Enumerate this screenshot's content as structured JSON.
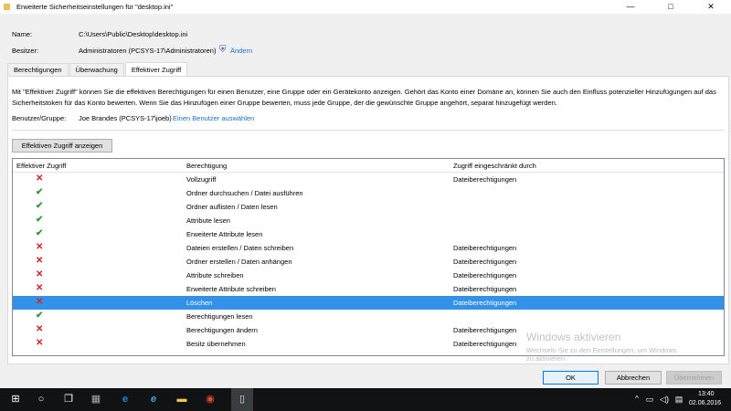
{
  "window": {
    "title": "Erweiterte Sicherheitseinstellungen für \"desktop.ini\"",
    "minimize": "—",
    "maximize": "□",
    "close": "✕"
  },
  "info": {
    "name_label": "Name:",
    "name_value": "C:\\Users\\Public\\Desktop\\desktop.ini",
    "owner_label": "Besitzer:",
    "owner_value": "Administratoren (PCSYS-17\\Administratoren)",
    "change_link": "Ändern"
  },
  "tabs": [
    {
      "label": "Berechtigungen"
    },
    {
      "label": "Überwachung"
    },
    {
      "label": "Effektiver Zugriff"
    }
  ],
  "panel": {
    "desc1": "Mit \"Effektiver Zugriff\" können Sie die effektiven Berechtigungen für einen Benutzer, eine Gruppe oder ein Gerätekonto anzeigen. Gehört das Konto einer Domäne an, können Sie auch den Einfluss potenzieller Hinzufügungen auf das",
    "desc2": "Sicherheitstoken für das Konto bewerten. Wenn Sie das Hinzufügen einer Gruppe bewerten, muss jede Gruppe, der die gewünschte Gruppe angehört, separat hinzugefügt werden.",
    "user_label": "Benutzer/Gruppe:",
    "user_value": "Joe Brandes (PCSYS-17\\joeb)",
    "select_user_link": "Einen Benutzer auswählen",
    "show_button": "Effektiven Zugriff anzeigen"
  },
  "table": {
    "headers": [
      "Effektiver Zugriff",
      "Berechtigung",
      "Zugriff eingeschränkt durch"
    ],
    "rows": [
      {
        "access": "denied",
        "permission": "Vollzugriff",
        "restricted": "Dateiberechtigungen"
      },
      {
        "access": "allowed",
        "permission": "Ordner durchsuchen / Datei ausführen",
        "restricted": ""
      },
      {
        "access": "allowed",
        "permission": "Ordner auflisten / Daten lesen",
        "restricted": ""
      },
      {
        "access": "allowed",
        "permission": "Attribute lesen",
        "restricted": ""
      },
      {
        "access": "allowed",
        "permission": "Erweiterte Attribute lesen",
        "restricted": ""
      },
      {
        "access": "denied",
        "permission": "Dateien erstellen / Daten schreiben",
        "restricted": "Dateiberechtigungen"
      },
      {
        "access": "denied",
        "permission": "Ordner erstellen / Daten anhängen",
        "restricted": "Dateiberechtigungen"
      },
      {
        "access": "denied",
        "permission": "Attribute schreiben",
        "restricted": "Dateiberechtigungen"
      },
      {
        "access": "denied",
        "permission": "Erweiterte Attribute schreiben",
        "restricted": "Dateiberechtigungen"
      },
      {
        "access": "denied",
        "permission": "Löschen",
        "restricted": "Dateiberechtigungen",
        "selected": true
      },
      {
        "access": "allowed",
        "permission": "Berechtigungen lesen",
        "restricted": ""
      },
      {
        "access": "denied",
        "permission": "Berechtigungen ändern",
        "restricted": "Dateiberechtigungen"
      },
      {
        "access": "denied",
        "permission": "Besitz übernehmen",
        "restricted": "Dateiberechtigungen"
      }
    ]
  },
  "buttons": {
    "ok": "OK",
    "cancel": "Abbrechen",
    "apply": "Übernehmen"
  },
  "watermark": {
    "title": "Windows aktivieren",
    "line1": "Wechseln Sie zu den Einstellungen, um Windows",
    "line2": "zu aktivieren."
  },
  "taskbar": {
    "time": "13:40",
    "date": "02.06.2016"
  }
}
